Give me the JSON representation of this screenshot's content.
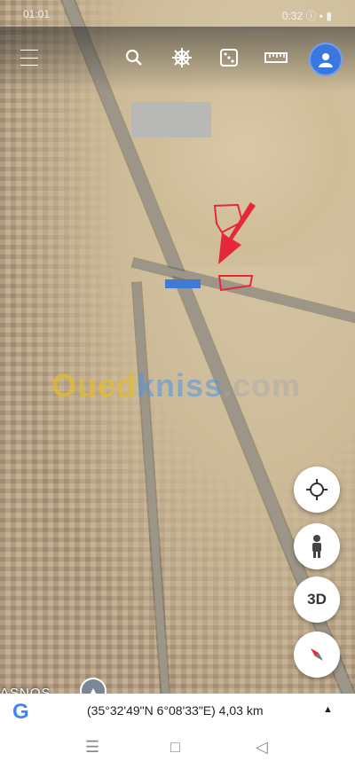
{
  "status_bar": {
    "time": "01:01",
    "right_text": "0:32 ⓘ ▪ ▮"
  },
  "toolbar": {
    "icons": [
      "menu-icon",
      "search-icon",
      "ship-wheel-icon",
      "dice-icon",
      "ruler-icon",
      "profile-avatar"
    ]
  },
  "watermark": {
    "part1": "Oued",
    "part2": "kniss",
    "part3": ".com"
  },
  "map_labels": {
    "place": "ASNOS"
  },
  "controls": {
    "threeD_label": "3D"
  },
  "info_bar": {
    "logo": "G",
    "coordinates": "(35°32'49\"N 6°08'33\"E) 4,03 km",
    "caret": "▲"
  },
  "nav_bar": {
    "recents": "☰",
    "home": "□",
    "back": "◁"
  },
  "colors": {
    "accent_blue": "#3b77e0",
    "marker_red": "#e8263a"
  }
}
